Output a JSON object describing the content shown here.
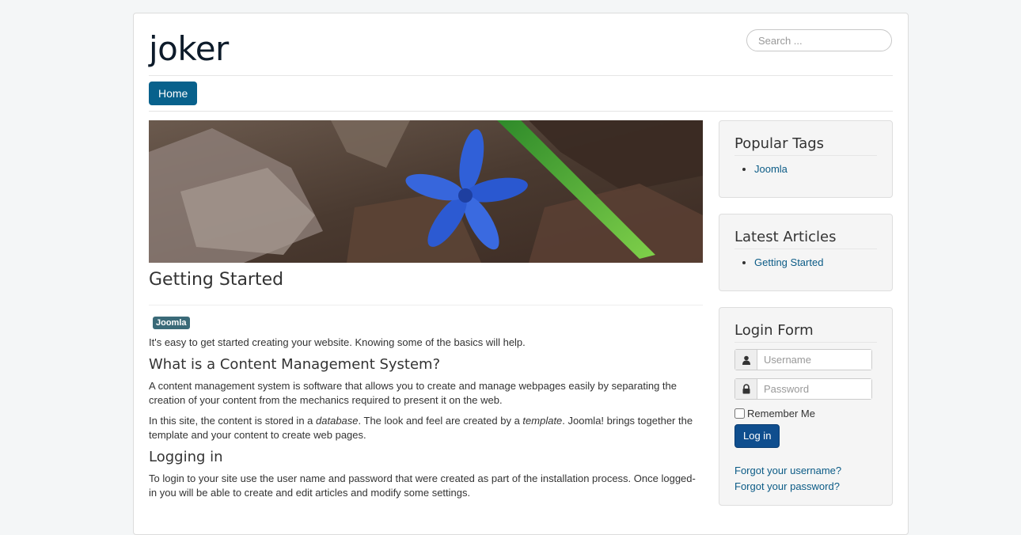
{
  "site": {
    "title": "joker"
  },
  "search": {
    "placeholder": "Search ..."
  },
  "nav": {
    "home_label": "Home"
  },
  "article": {
    "title": "Getting Started",
    "tag": "Joomla",
    "intro": "It's easy to get started creating your website. Knowing some of the basics will help.",
    "h_cms": "What is a Content Management System?",
    "p_cms": "A content management system is software that allows you to create and manage webpages easily by separating the creation of your content from the mechanics required to present it on the web.",
    "p_site_1": "In this site, the content is stored in a ",
    "p_site_db": "database",
    "p_site_2": ". The look and feel are created by a ",
    "p_site_tpl": "template",
    "p_site_3": ". Joomla! brings together the template and your content to create web pages.",
    "h_login": "Logging in",
    "p_login": "To login to your site use the user name and password that were created as part of the installation process. Once logged-in you will be able to create and edit articles and modify some settings."
  },
  "sidebar": {
    "popular_tags": {
      "title": "Popular Tags",
      "items": [
        "Joomla"
      ]
    },
    "latest_articles": {
      "title": "Latest Articles",
      "items": [
        "Getting Started"
      ]
    },
    "login": {
      "title": "Login Form",
      "username_placeholder": "Username",
      "password_placeholder": "Password",
      "remember_label": "Remember Me",
      "button_label": "Log in",
      "forgot_username": "Forgot your username?",
      "forgot_password": "Forgot your password?"
    }
  },
  "colors": {
    "accent": "#08618c",
    "link": "#0b5b86",
    "login_button": "#0f4e8e"
  }
}
